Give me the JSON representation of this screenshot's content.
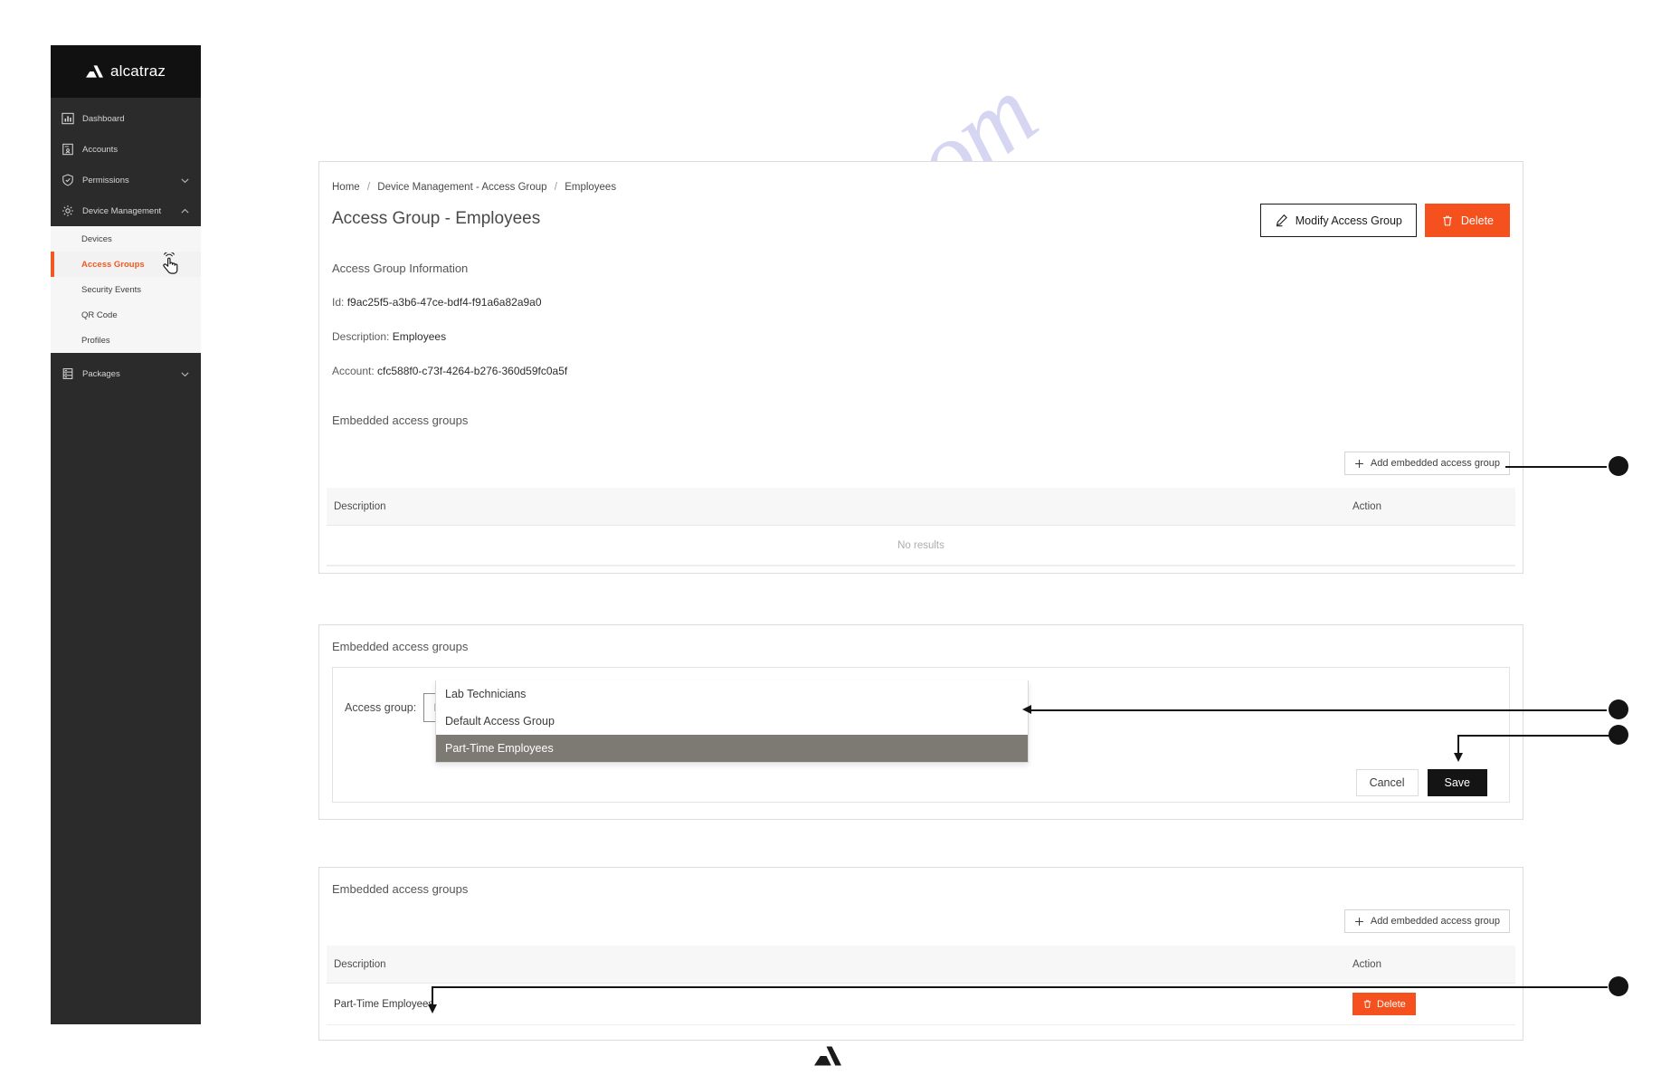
{
  "brand": {
    "name": "alcatraz",
    "logo_icon": "alcatraz-a-mark"
  },
  "sidebar": {
    "top_items": [
      {
        "label": "Dashboard",
        "icon": "chart-bar-icon",
        "chevron": ""
      },
      {
        "label": "Accounts",
        "icon": "account-card-icon",
        "chevron": ""
      },
      {
        "label": "Permissions",
        "icon": "shield-check-icon",
        "chevron": "chevron-down-icon"
      },
      {
        "label": "Device Management",
        "icon": "gear-icon",
        "chevron": "chevron-up-icon"
      }
    ],
    "sub_items": [
      {
        "label": "Devices",
        "active": false
      },
      {
        "label": "Access Groups",
        "active": true
      },
      {
        "label": "Security Events",
        "active": false
      },
      {
        "label": "QR Code",
        "active": false
      },
      {
        "label": "Profiles",
        "active": false
      }
    ],
    "bottom_items": [
      {
        "label": "Packages",
        "icon": "server-stack-icon",
        "chevron": "chevron-down-icon"
      }
    ],
    "active_color": "#f05a22",
    "cursor_icon": "tap-cursor-icon"
  },
  "top_card": {
    "breadcrumb": [
      "Home",
      "Device Management - Access Group",
      "Employees"
    ],
    "breadcrumb_separator": "/",
    "title": "Access Group - Employees",
    "actions": {
      "modify_label": "Modify Access Group",
      "modify_icon": "pencil-icon",
      "delete_label": "Delete",
      "delete_icon": "trash-icon"
    },
    "info_heading": "Access Group Information",
    "fields": [
      {
        "key": "Id:",
        "value": "f9ac25f5-a3b6-47ce-bdf4-f91a6a82a9a0"
      },
      {
        "key": "Description:",
        "value": "Employees"
      },
      {
        "key": "Account:",
        "value": "cfc588f0-c73f-4264-b276-360d59fc0a5f"
      }
    ],
    "embedded_heading": "Embedded access groups",
    "add_button_label": "Add embedded access group",
    "add_button_icon": "plus-icon",
    "table": {
      "columns": [
        "Description",
        "Action"
      ],
      "rows": [],
      "empty_text": "No results"
    }
  },
  "mid_card": {
    "heading": "Embedded access groups",
    "field_label": "Access group:",
    "combo": {
      "value": "Part-Time Employees",
      "placeholder": "Part-Time Employees",
      "search_icon": "search-icon"
    },
    "dropdown_options": [
      {
        "label": "Lab Technicians",
        "selected": false
      },
      {
        "label": "Default Access Group",
        "selected": false
      },
      {
        "label": "Part-Time Employees",
        "selected": true
      }
    ],
    "cancel_label": "Cancel",
    "save_label": "Save"
  },
  "bottom_card": {
    "heading": "Embedded access groups",
    "add_button_label": "Add embedded access group",
    "add_button_icon": "plus-icon",
    "table": {
      "columns": [
        "Description",
        "Action"
      ],
      "rows": [
        {
          "description": "Part-Time Employees",
          "action_label": "Delete",
          "action_icon": "trash-icon"
        }
      ]
    }
  },
  "watermark": {
    "text": "manualshive.com",
    "color": "#c9c7ee"
  },
  "callouts": {
    "count": 4,
    "color": "#141414"
  },
  "footer": {
    "logo_icon": "alcatraz-a-mark"
  }
}
